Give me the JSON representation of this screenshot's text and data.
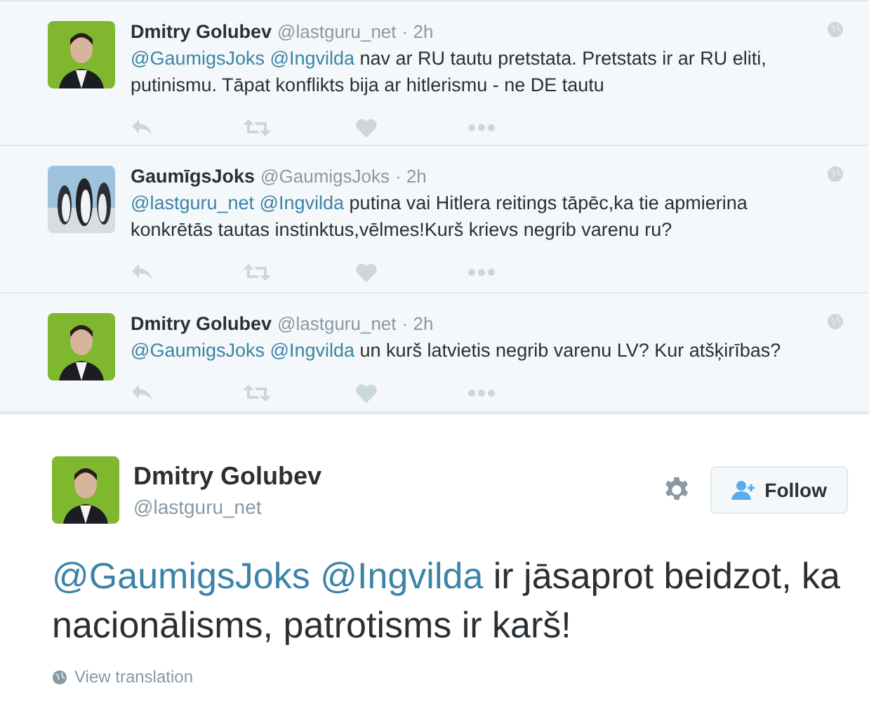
{
  "replies": [
    {
      "name": "Dmitry Golubev",
      "handle": "@lastguru_net",
      "time": "· 2h",
      "avatar": {
        "kind": "picture"
      },
      "mentions": [
        "@GaumigsJoks",
        "@Ingvilda"
      ],
      "text": "nav ar RU tautu pretstata. Pretstats ir ar RU eliti, putinismu. Tāpat konflikts bija ar hitlerismu - ne DE tautu"
    },
    {
      "name": "GaumīgsJoks",
      "handle": "@GaumigsJoks",
      "time": "· 2h",
      "avatar": {
        "kind": "penguins"
      },
      "mentions": [
        "@lastguru_net",
        "@Ingvilda"
      ],
      "text": "putina vai Hitlera reitings tāpēc,ka tie apmierina konkrētās tautas instinktus,vēlmes!Kurš krievs negrib varenu ru?"
    },
    {
      "name": "Dmitry Golubev",
      "handle": "@lastguru_net",
      "time": "· 2h",
      "avatar": {
        "kind": "picture"
      },
      "mentions": [
        "@GaumigsJoks",
        "@Ingvilda"
      ],
      "text": "un kurš latvietis negrib varenu LV? Kur atšķirības?"
    }
  ],
  "main": {
    "name": "Dmitry Golubev",
    "handle": "@lastguru_net",
    "follow_label": "Follow",
    "mentions": [
      "@GaumigsJoks",
      "@Ingvilda"
    ],
    "text": "ir jāsaprot beidzot, ka nacionālisms, patrotisms ir karš!",
    "translation_link": "View translation"
  }
}
